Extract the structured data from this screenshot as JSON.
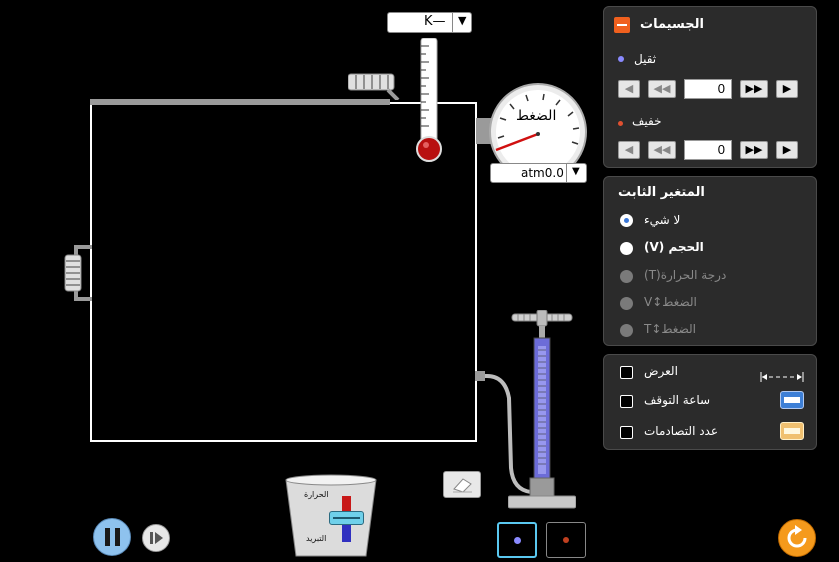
{
  "thermometer": {
    "unit": "K—",
    "dropdown_arrow": "▼"
  },
  "pressure_gauge": {
    "label": "الضغط",
    "value": "atm0.0",
    "dropdown_arrow": "▼"
  },
  "particles_panel": {
    "title": "الجسيمات",
    "heavy": {
      "label": "ثقيل",
      "value": "0",
      "color": "#6a6aff"
    },
    "light": {
      "label": "خفيف",
      "value": "0",
      "color": "#e05030"
    }
  },
  "constant_panel": {
    "title": "المتغير الثابت",
    "options": [
      {
        "label": "لا شيء",
        "selected": true,
        "enabled": true
      },
      {
        "label": "الحجم (V)",
        "selected": false,
        "enabled": true
      },
      {
        "label": "درجة الحرارة(T)",
        "selected": false,
        "enabled": false
      },
      {
        "label": "الضغط↕V",
        "selected": false,
        "enabled": false
      },
      {
        "label": "الضغط↕T",
        "selected": false,
        "enabled": false
      }
    ]
  },
  "options_panel": {
    "items": [
      {
        "label": "العرض",
        "icon": "width-ruler-icon"
      },
      {
        "label": "ساعة التوقف",
        "icon": "stopwatch-icon"
      },
      {
        "label": "عدد التصادمات",
        "icon": "collision-counter-icon"
      }
    ]
  },
  "heater": {
    "heat_label": "الحرارة",
    "cool_label": "التبريد"
  },
  "colors": {
    "accent": "#f0601e",
    "heavy": "#6a6aff",
    "light": "#e05030",
    "container": "#ffffff"
  }
}
